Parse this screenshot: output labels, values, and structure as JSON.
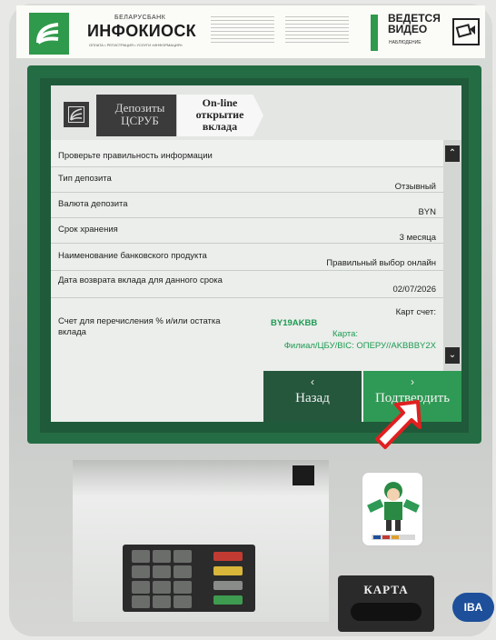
{
  "banner": {
    "bank": "БЕЛАРУСБАНК",
    "title": "ИНФОКИОСК",
    "subtitle": "ОПЛАТА • РЕГИСТРАЦИЯ • УСЛУГИ «ИНФОРМАЦИЯ»",
    "video_line1": "ВЕДЕТСЯ",
    "video_line2": "ВИДЕО",
    "video_line3": "НАБЛЮДЕНИЕ"
  },
  "breadcrumb": {
    "item1": "Депозиты ЦСРУБ",
    "item2": "On-line открытие вклада"
  },
  "form": {
    "header": "Проверьте правильность информации",
    "rows": [
      {
        "label": "Тип депозита",
        "value": "Отзывный"
      },
      {
        "label": "Валюта депозита",
        "value": "BYN"
      },
      {
        "label": "Срок хранения",
        "value": "3 месяца"
      },
      {
        "label": "Наименование банковского продукта",
        "value": "Правильный выбор онлайн"
      },
      {
        "label": "Дата возврата вклада для данного срока",
        "value": "02/07/2026"
      }
    ],
    "account": {
      "label": "Счет для перечисления % и/или остатка вклада",
      "card_account_label": "Карт счет:",
      "iban": "BY19AKBB",
      "card_label": "Карта:",
      "branch": "Филиал/ЦБУ/BIC: ОПЕРУ//AKBBBY2X"
    }
  },
  "buttons": {
    "back": "Назад",
    "confirm": "Подтвердить"
  },
  "card_reader": {
    "label": "КАРТА"
  },
  "badge": {
    "label": "IBA"
  },
  "colors": {
    "frame": "#246c44",
    "confirm": "#2f9a55",
    "back": "#25573d",
    "pointer_outline": "#e02020"
  }
}
